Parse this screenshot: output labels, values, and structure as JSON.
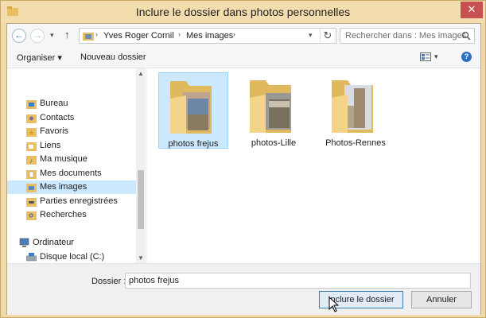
{
  "window": {
    "title": "Inclure le dossier dans photos personnelles",
    "close_glyph": "✕"
  },
  "address_bar": {
    "back_glyph": "←",
    "forward_glyph": "→",
    "recent_glyph": "▾",
    "up_glyph": "↑",
    "breadcrumbs": [
      "Yves Roger Cornil",
      "Mes images"
    ],
    "separator": "›",
    "dropdown_glyph": "▾",
    "refresh_glyph": "↻"
  },
  "search": {
    "placeholder": "Rechercher dans : Mes images"
  },
  "toolbar": {
    "organize": "Organiser ▾",
    "new_folder": "Nouveau dossier",
    "view_dropdown": "▾",
    "help": "?"
  },
  "nav_pane": {
    "scroll_up": "▲",
    "scroll_down": "▼",
    "items": [
      {
        "label": "Bureau",
        "icon": "desktop-icon"
      },
      {
        "label": "Contacts",
        "icon": "contacts-icon"
      },
      {
        "label": "Favoris",
        "icon": "favorites-icon"
      },
      {
        "label": "Liens",
        "icon": "links-icon"
      },
      {
        "label": "Ma musique",
        "icon": "music-icon"
      },
      {
        "label": "Mes documents",
        "icon": "documents-icon"
      },
      {
        "label": "Mes images",
        "icon": "pictures-icon",
        "selected": true
      },
      {
        "label": "Parties enregistrées",
        "icon": "saved-games-icon"
      },
      {
        "label": "Recherches",
        "icon": "searches-icon"
      }
    ],
    "computer": {
      "label": "Ordinateur",
      "icon": "computer-icon"
    },
    "drive": {
      "label": "Disque local (C:)",
      "icon": "drive-icon"
    }
  },
  "folders": [
    {
      "label": "photos frejus",
      "selected": true
    },
    {
      "label": "photos-Lille",
      "selected": false
    },
    {
      "label": "Photos-Rennes",
      "selected": false
    }
  ],
  "footer": {
    "folder_label": "Dossier :",
    "folder_value": "photos frejus",
    "include_button": "Inclure le dossier",
    "cancel_button": "Annuler"
  },
  "colors": {
    "frame": "#f0d9a8",
    "selection": "#cce8ff",
    "accent": "#3c7fb1",
    "close": "#c75050"
  }
}
